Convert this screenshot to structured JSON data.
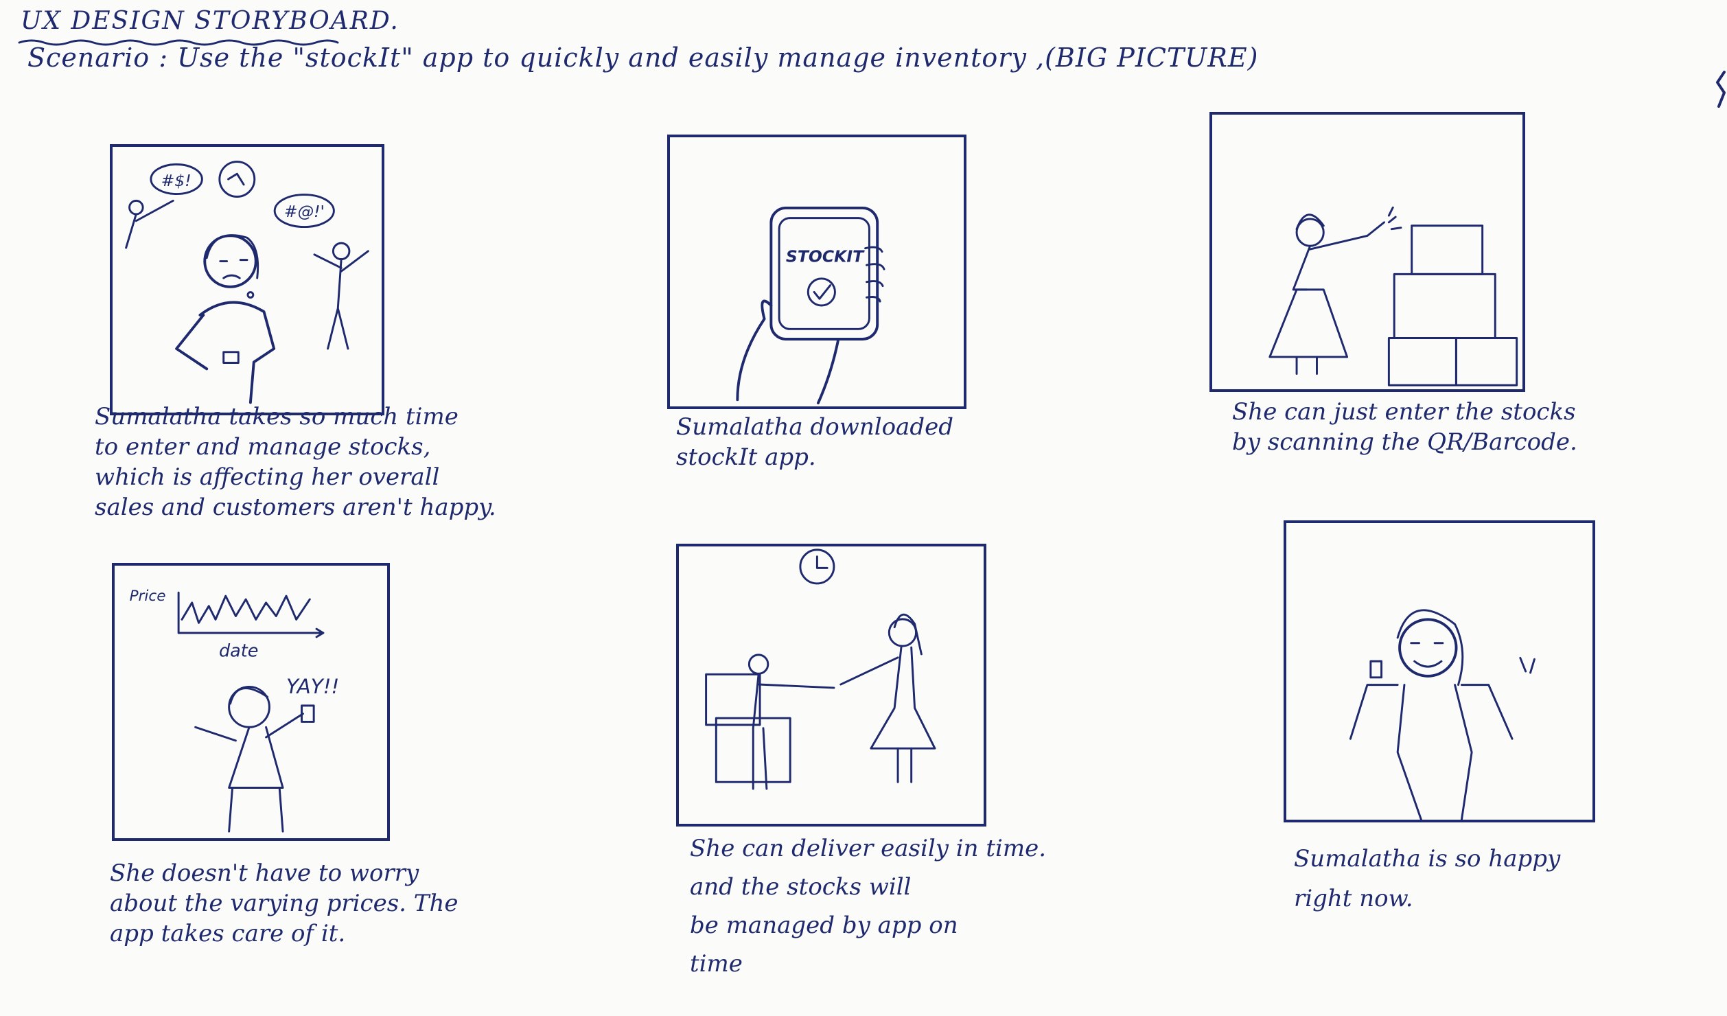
{
  "header": {
    "title": "UX DESIGN STORYBOARD.",
    "scenario": "Scenario : Use the \"stockIt\" app to quickly and easily manage inventory ,(BIG PICTURE)"
  },
  "panels": [
    {
      "caption": "Sumalatha takes so much time\nto enter and manage stocks,\nwhich is affecting her overall\nsales and customers aren't happy.",
      "bubble_left": "#$!",
      "bubble_right": "#@!'"
    },
    {
      "caption": "Sumalatha downloaded\nstockIt app.",
      "phone_label": "STOCKIT"
    },
    {
      "caption": "She can just enter the stocks\nby scanning the QR/Barcode."
    },
    {
      "caption": "She doesn't have to worry\nabout the varying prices. The\napp takes care of it.",
      "chart_ylabel": "Price",
      "chart_xlabel": "date",
      "exclaim": "YAY!!"
    },
    {
      "caption": "She can deliver easily in time.\nand the stocks will\nbe managed by app on\ntime"
    },
    {
      "caption": "Sumalatha is so happy\nright now."
    }
  ],
  "colors": {
    "ink": "#1f2a6e",
    "paper": "#fbfbfa"
  }
}
